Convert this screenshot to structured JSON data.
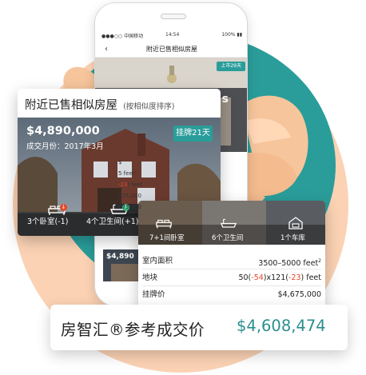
{
  "colors": {
    "teal": "#2a9d9a",
    "peach": "#fbd2b4",
    "banner_value": "#2a8e8f",
    "negative": "#e8472a"
  },
  "phone": {
    "status": {
      "carrier": "●●●○○ 中国移动",
      "time": "14:54",
      "battery": "100% ▮▮"
    },
    "nav_title": "附近已售相似房屋",
    "back_icon": "chevron-left-icon",
    "badge": "上市29天",
    "ghost_text": "res",
    "list_lines": [
      {
        "pre": "$",
        "red": "",
        "post": ""
      },
      {
        "pre": "5 feet²",
        "red": "",
        "post": ""
      },
      {
        "pre": "",
        "red": "-23",
        "post": ") feet"
      },
      {
        "pre": "675,000",
        "red": "",
        "post": ""
      },
      {
        "pre": "675,000",
        "red": "",
        "post": ""
      }
    ],
    "thumb_price": "$4,890"
  },
  "similar_card": {
    "title": "附近已售相似房屋",
    "subtitle": "(按相似度排序)",
    "price": "$4,890,000",
    "sold_month": "成交月份：2017年3月",
    "listed_badge": "挂牌21天",
    "features": [
      {
        "icon": "bed-icon",
        "label": "3个卧室(-1)",
        "dot": "↓",
        "dot_color": "#e8472a"
      },
      {
        "icon": "bathtub-icon",
        "label": "4个卫生间(+1)",
        "dot": "↑",
        "dot_color": "#33b679"
      }
    ]
  },
  "detail_card": {
    "features": [
      {
        "icon": "bed-icon",
        "label": "7+1间卧室"
      },
      {
        "icon": "bathtub-icon",
        "label": "6个卫生间"
      },
      {
        "icon": "garage-icon",
        "label": "1个车库"
      }
    ],
    "rows": [
      {
        "key": "室内面积",
        "value": "3500–5000 feet",
        "sup": "2"
      },
      {
        "key": "地块",
        "value_parts": [
          "50(",
          "-54",
          ")x121(",
          "-23",
          ") feet"
        ]
      },
      {
        "key": "挂牌价",
        "value": "$4,675,000"
      }
    ]
  },
  "banner": {
    "label": "房智汇®参考成交价",
    "value": "$4,608,474"
  }
}
